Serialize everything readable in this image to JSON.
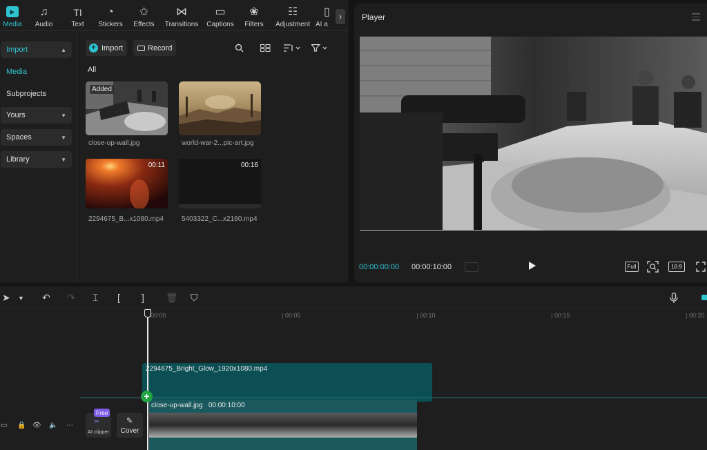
{
  "toolbar": {
    "items": [
      {
        "label": "Media",
        "icon": "media-icon",
        "active": true
      },
      {
        "label": "Audio",
        "icon": "audio-icon"
      },
      {
        "label": "Text",
        "icon": "text-icon"
      },
      {
        "label": "Stickers",
        "icon": "stickers-icon"
      },
      {
        "label": "Effects",
        "icon": "effects-icon"
      },
      {
        "label": "Transitions",
        "icon": "transitions-icon"
      },
      {
        "label": "Captions",
        "icon": "captions-icon"
      },
      {
        "label": "Filters",
        "icon": "filters-icon"
      },
      {
        "label": "Adjustment",
        "icon": "adjustment-icon"
      },
      {
        "label": "AI a",
        "icon": "ai-icon"
      }
    ],
    "glyphs": {
      "audio": "♫",
      "text": "TI",
      "stickers": "◔",
      "effects": "✩",
      "transitions": "⋈",
      "captions": "▭",
      "filters": "❀",
      "adjustment": "☷",
      "ai": "▯",
      "scroll": "›"
    }
  },
  "side_nav": {
    "import": "Import",
    "media": "Media",
    "subprojects": "Subprojects",
    "yours": "Yours",
    "spaces": "Spaces",
    "library": "Library"
  },
  "media": {
    "import_button": "Import",
    "record_button": "Record",
    "all_label": "All",
    "items": [
      {
        "name": "close-up-wall.jpg",
        "badge": "Added"
      },
      {
        "name": "world-war-2...pic-art.jpg"
      },
      {
        "name": "2294675_B...x1080.mp4",
        "duration": "00:11"
      },
      {
        "name": "5403322_C...x2160.mp4",
        "duration": "00:16"
      }
    ]
  },
  "player": {
    "title": "Player",
    "current_time": "00:00:00:00",
    "total_time": "00:00:10:00",
    "full_label": "Full",
    "ratio_label": "16:9"
  },
  "timeline": {
    "ruler": [
      "00:00",
      "00:05",
      "00:10",
      "00:15",
      "00:20"
    ],
    "main_clip_name": "2294675_Bright_Glow_1920x1080.mp4",
    "image_clip_name": "close-up-wall.jpg",
    "image_clip_duration": "00:00:10:00",
    "ai_clipper_badge": "Free",
    "ai_clipper_label": "AI clipper",
    "cover_label": "Cover"
  },
  "colors": {
    "accent": "#2fc2cf",
    "clip": "#0b4f54",
    "add": "#22a444",
    "free_badge": "#7d5ce8"
  }
}
